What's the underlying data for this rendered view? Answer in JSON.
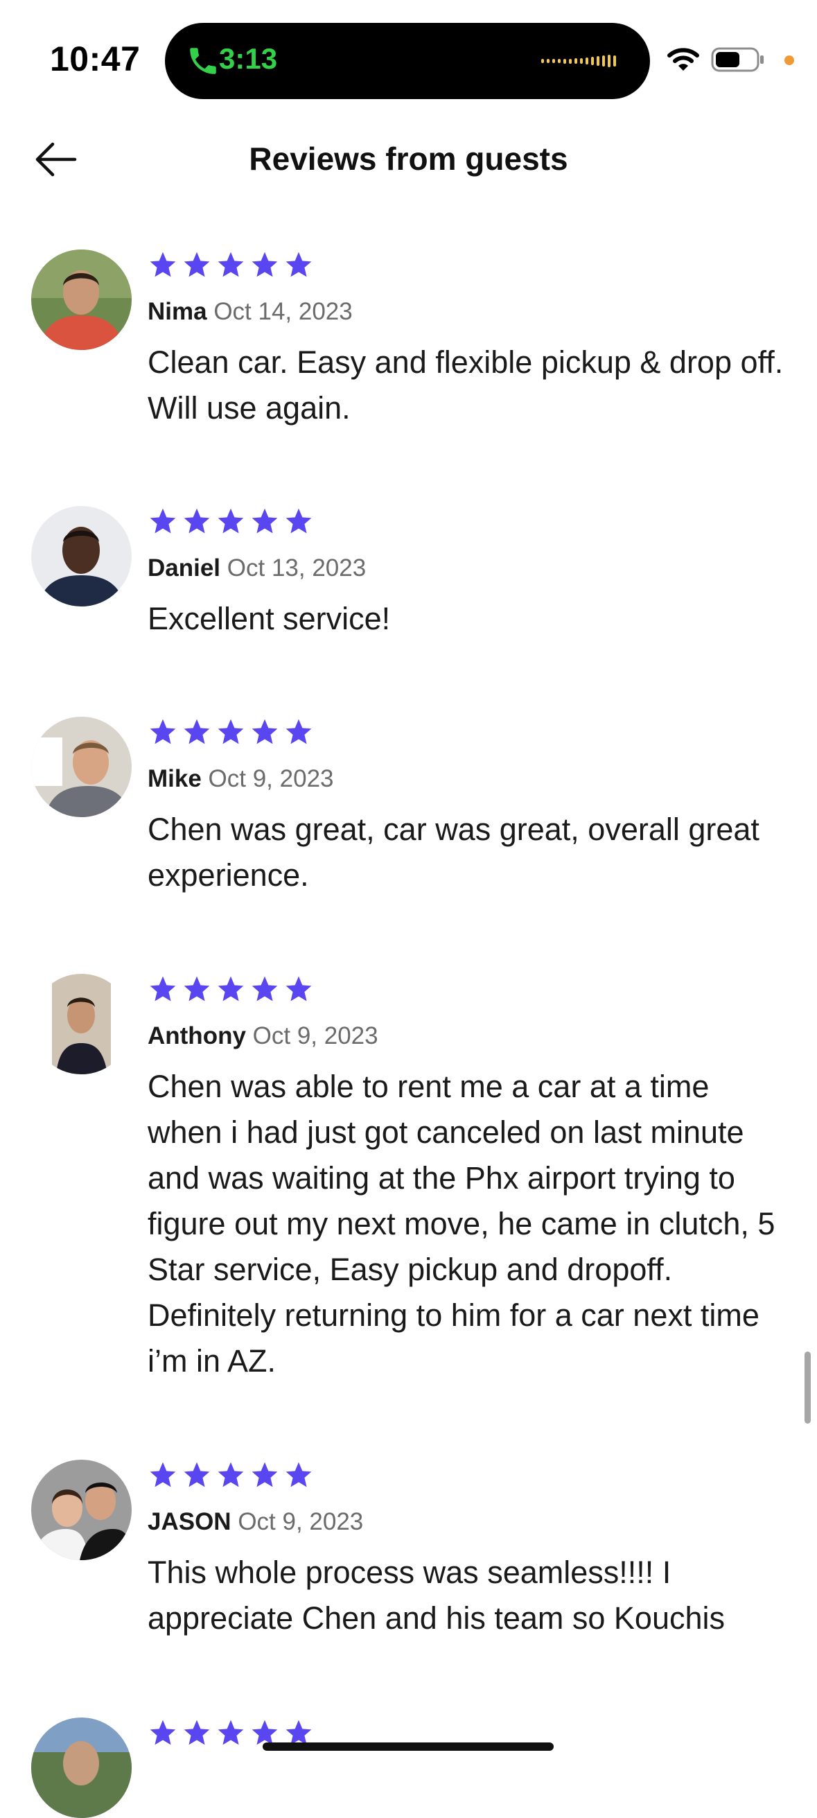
{
  "status_bar": {
    "time": "10:47",
    "call_time": "3:13",
    "accent_call": "#33d04a"
  },
  "header": {
    "title": "Reviews from guests",
    "back_icon": "arrow-left-icon"
  },
  "star_color": "#5a46f0",
  "reviews": [
    {
      "name": "Nima",
      "date": "Oct 14, 2023",
      "rating": 5,
      "text": "Clean car. Easy and flexible pickup & drop off. Will use again."
    },
    {
      "name": "Daniel",
      "date": "Oct 13, 2023",
      "rating": 5,
      "text": "Excellent service!"
    },
    {
      "name": "Mike",
      "date": "Oct 9, 2023",
      "rating": 5,
      "text": "Chen was great, car was great, overall great experience."
    },
    {
      "name": "Anthony",
      "date": "Oct 9, 2023",
      "rating": 5,
      "text": "Chen was able to rent me a car at a time when i had just got canceled on last minute and was waiting at the Phx airport trying to figure out my next move, he came in clutch, 5 Star service, Easy pickup and dropoff. Definitely returning to him for a car next time i’m in AZ."
    },
    {
      "name": "JASON",
      "date": "Oct 9, 2023",
      "rating": 5,
      "text": "This whole process was seamless!!!! I appreciate Chen and his team so Kouchis"
    },
    {
      "name": "",
      "date": "",
      "rating": 5,
      "text": ""
    }
  ]
}
